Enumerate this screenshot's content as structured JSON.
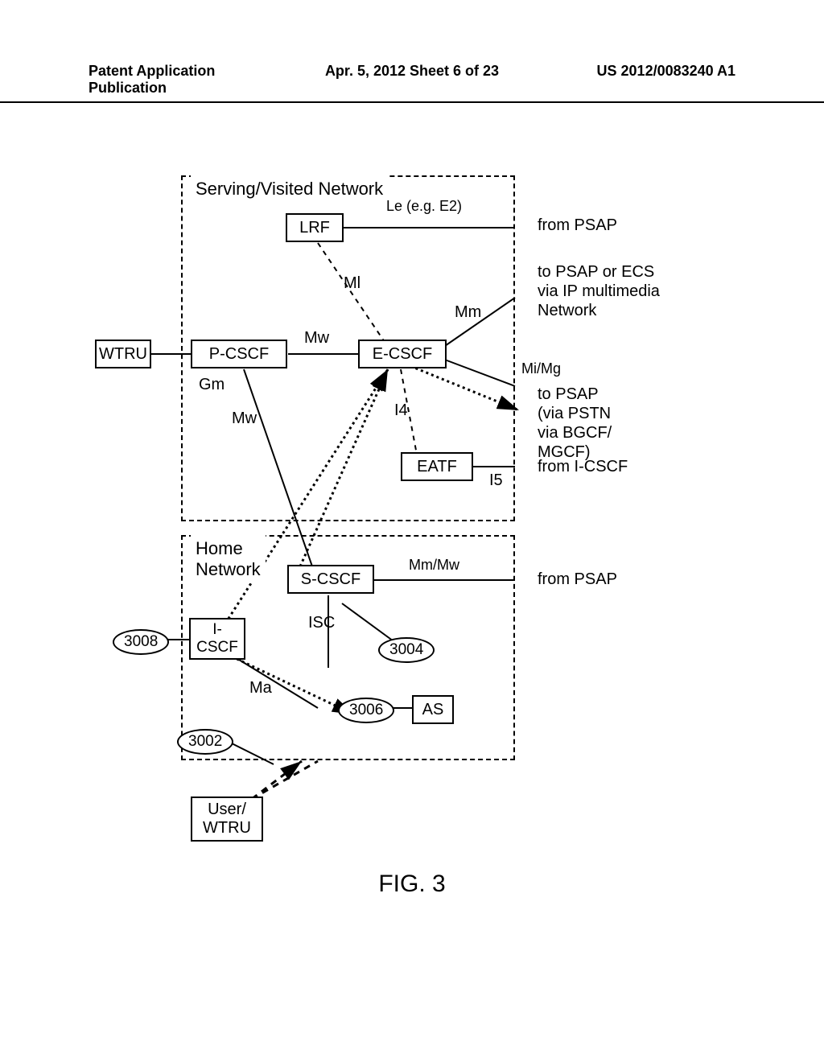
{
  "header": {
    "left": "Patent Application Publication",
    "mid": "Apr. 5, 2012  Sheet 6 of 23",
    "right": "US 2012/0083240 A1"
  },
  "regions": {
    "serving_visited": "Serving/Visited Network",
    "home": "Home\nNetwork"
  },
  "nodes": {
    "wtru1": "WTRU",
    "pcscf": "P-CSCF",
    "lrf": "LRF",
    "ecscf": "E-CSCF",
    "eatf": "EATF",
    "scscf": "S-CSCF",
    "icscf": "I-\nCSCF",
    "as": "AS",
    "user": "User/\nWTRU"
  },
  "callouts": {
    "c3008": "3008",
    "c3004": "3004",
    "c3006": "3006",
    "c3002": "3002"
  },
  "labels": {
    "le": "Le (e.g. E2)",
    "ml": "Ml",
    "mm": "Mm",
    "mw1": "Mw",
    "mw2": "Mw",
    "gm": "Gm",
    "i4": "I4",
    "mimg": "Mi/Mg",
    "i5": "I5",
    "mmmw": "Mm/Mw",
    "isc": "ISC",
    "ma": "Ma",
    "from_psap_1": "from PSAP",
    "to_psap_ecs": "to PSAP or ECS\nvia IP multimedia\nNetwork",
    "to_psap_pstn": "to PSAP\n(via PSTN\nvia BGCF/\nMGCF)",
    "from_icscf": "from I-CSCF",
    "from_psap_2": "from PSAP"
  },
  "figure_caption": "FIG. 3"
}
